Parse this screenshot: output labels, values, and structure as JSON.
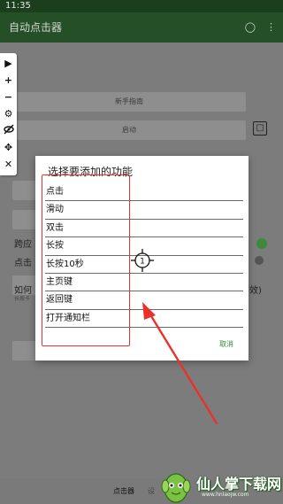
{
  "status_bar": {
    "time": "11:35"
  },
  "app_bar": {
    "title": "自动点击器"
  },
  "background": {
    "guide_button": "新手指南",
    "start_button": "启动",
    "row_label_1": "跨应",
    "row_label_2": "点击",
    "row_label_3": "如何",
    "row_small_text": "长按卡",
    "row_suffix": "效)",
    "bottom_nav_label": "点击器",
    "bottom_nav_label_2": "设"
  },
  "dialog": {
    "title": "选择要添加的功能",
    "options": [
      "点击",
      "滑动",
      "双击",
      "长按",
      "长按10秒",
      "主页键",
      "返回键",
      "打开通知栏"
    ],
    "cancel_label": "取消"
  },
  "target_marker": {
    "label": "1"
  },
  "toolbar": {
    "icons": [
      "play-icon",
      "plus-icon",
      "minus-icon",
      "gear-icon",
      "eye-off-icon",
      "move-icon",
      "close-icon"
    ]
  },
  "watermark": {
    "brand": "仙人掌下载网",
    "url": "www.hnlaojw.com"
  },
  "colors": {
    "app_bar": "#254f27",
    "accent_green": "#2f8a3a",
    "annotation_red": "#e8322c"
  }
}
